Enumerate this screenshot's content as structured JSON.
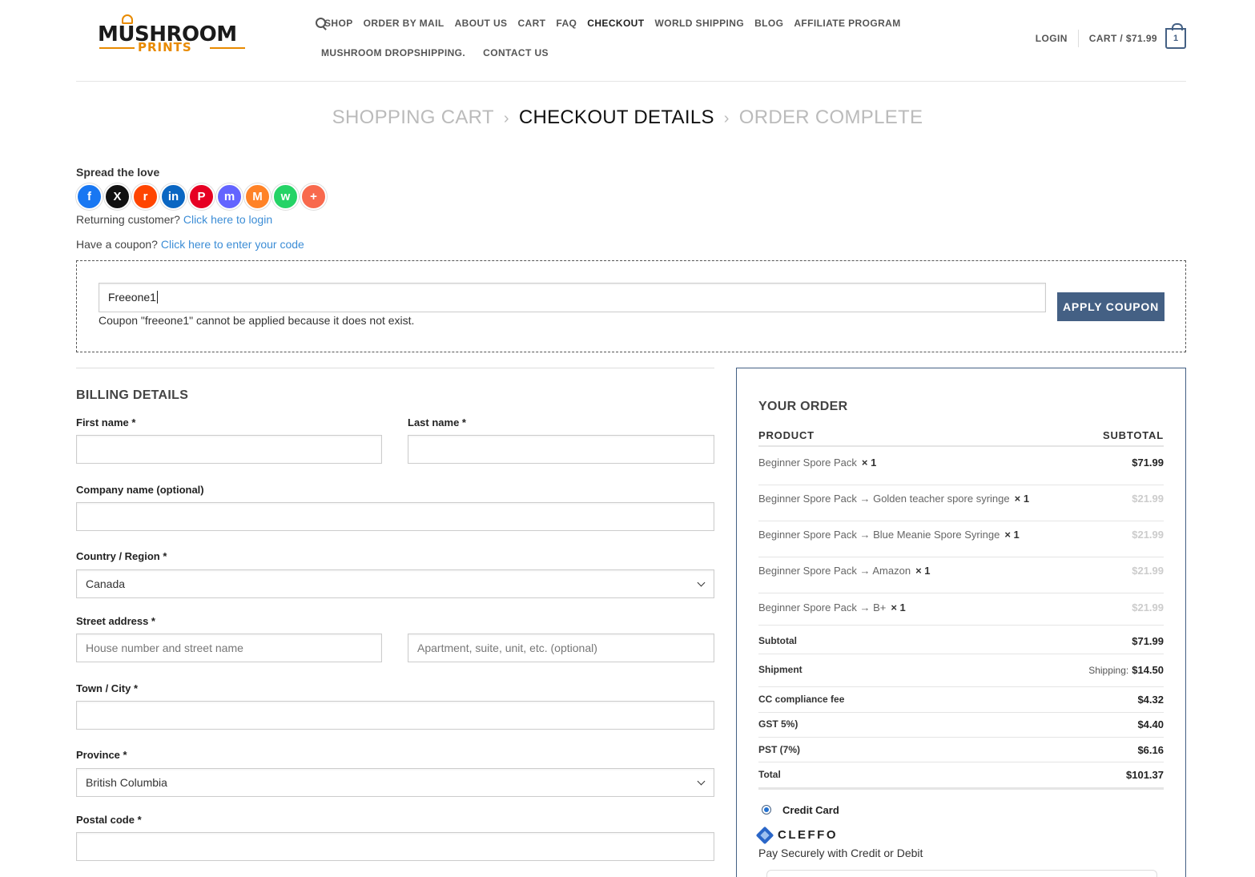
{
  "header": {
    "logo_top": "MUSHROOM",
    "logo_bottom": "PRINTS",
    "nav_row1": [
      "SHOP",
      "ORDER BY MAIL",
      "ABOUT US",
      "CART",
      "FAQ",
      "CHECKOUT",
      "WORLD SHIPPING",
      "BLOG",
      "AFFILIATE PROGRAM"
    ],
    "nav_row2": [
      "MUSHROOM DROPSHIPPING.",
      "CONTACT US"
    ],
    "login": "LOGIN",
    "cart_label": "CART / $71.99",
    "cart_count": "1"
  },
  "steps": {
    "s1": "SHOPPING CART",
    "s2": "CHECKOUT DETAILS",
    "s3": "ORDER COMPLETE"
  },
  "share": {
    "title": "Spread the love",
    "buttons": [
      {
        "icon": "facebook-icon",
        "glyph": "f",
        "color": "#1877f2"
      },
      {
        "icon": "x-icon",
        "glyph": "X",
        "color": "#111111"
      },
      {
        "icon": "reddit-icon",
        "glyph": "r",
        "color": "#ff4500"
      },
      {
        "icon": "linkedin-icon",
        "glyph": "in",
        "color": "#0a66c2"
      },
      {
        "icon": "pinterest-icon",
        "glyph": "P",
        "color": "#e60023"
      },
      {
        "icon": "mastodon-icon",
        "glyph": "m",
        "color": "#6364ff"
      },
      {
        "icon": "mix-icon",
        "glyph": "M",
        "color": "#ff8226"
      },
      {
        "icon": "whatsapp-icon",
        "glyph": "w",
        "color": "#25d366"
      },
      {
        "icon": "plus-icon",
        "glyph": "+",
        "color": "#f8694d"
      }
    ]
  },
  "notices": {
    "returning": "Returning customer?",
    "returning_link": "Click here to login",
    "coupon": "Have a coupon?",
    "coupon_link": "Click here to enter your code"
  },
  "coupon": {
    "value": "Freeone1",
    "button": "APPLY COUPON",
    "error": "Coupon \"freeone1\" cannot be applied because it does not exist."
  },
  "billing": {
    "title": "BILLING DETAILS",
    "first_name": "First name *",
    "last_name": "Last name *",
    "company": "Company name (optional)",
    "country_label": "Country / Region *",
    "country_value": "Canada",
    "street_label": "Street address *",
    "street_ph1": "House number and street name",
    "street_ph2": "Apartment, suite, unit, etc. (optional)",
    "city": "Town / City *",
    "province_label": "Province *",
    "province_value": "British Columbia",
    "postal": "Postal code *"
  },
  "order": {
    "title": "YOUR ORDER",
    "col_product": "PRODUCT",
    "col_subtotal": "SUBTOTAL",
    "items": [
      {
        "name": "Beginner Spore Pack",
        "qty": "× 1",
        "price": "$71.99"
      },
      {
        "name": "Beginner Spore Pack → Golden teacher spore syringe",
        "qty": "× 1",
        "price": "$21.99"
      },
      {
        "name": "Beginner Spore Pack → Blue Meanie Spore Syringe",
        "qty": "× 1",
        "price": "$21.99"
      },
      {
        "name": "Beginner Spore Pack → Amazon",
        "qty": "× 1",
        "price": "$21.99"
      },
      {
        "name": "Beginner Spore Pack → B+",
        "qty": "× 1",
        "price": "$21.99"
      }
    ],
    "subtotal_label": "Subtotal",
    "subtotal_value": "$71.99",
    "shipment_label": "Shipment",
    "shipment_prefix": "Shipping:",
    "shipment_value": "$14.50",
    "cc_label": "CC compliance fee",
    "cc_value": "$4.32",
    "gst_label": "GST 5%)",
    "gst_value": "$4.40",
    "pst_label": "PST (7%)",
    "pst_value": "$6.16",
    "total_label": "Total",
    "total_value": "$101.37",
    "pay_method": "Credit Card",
    "pay_brand": "CLEFFO",
    "pay_sub": "Pay Securely with Credit or Debit"
  }
}
